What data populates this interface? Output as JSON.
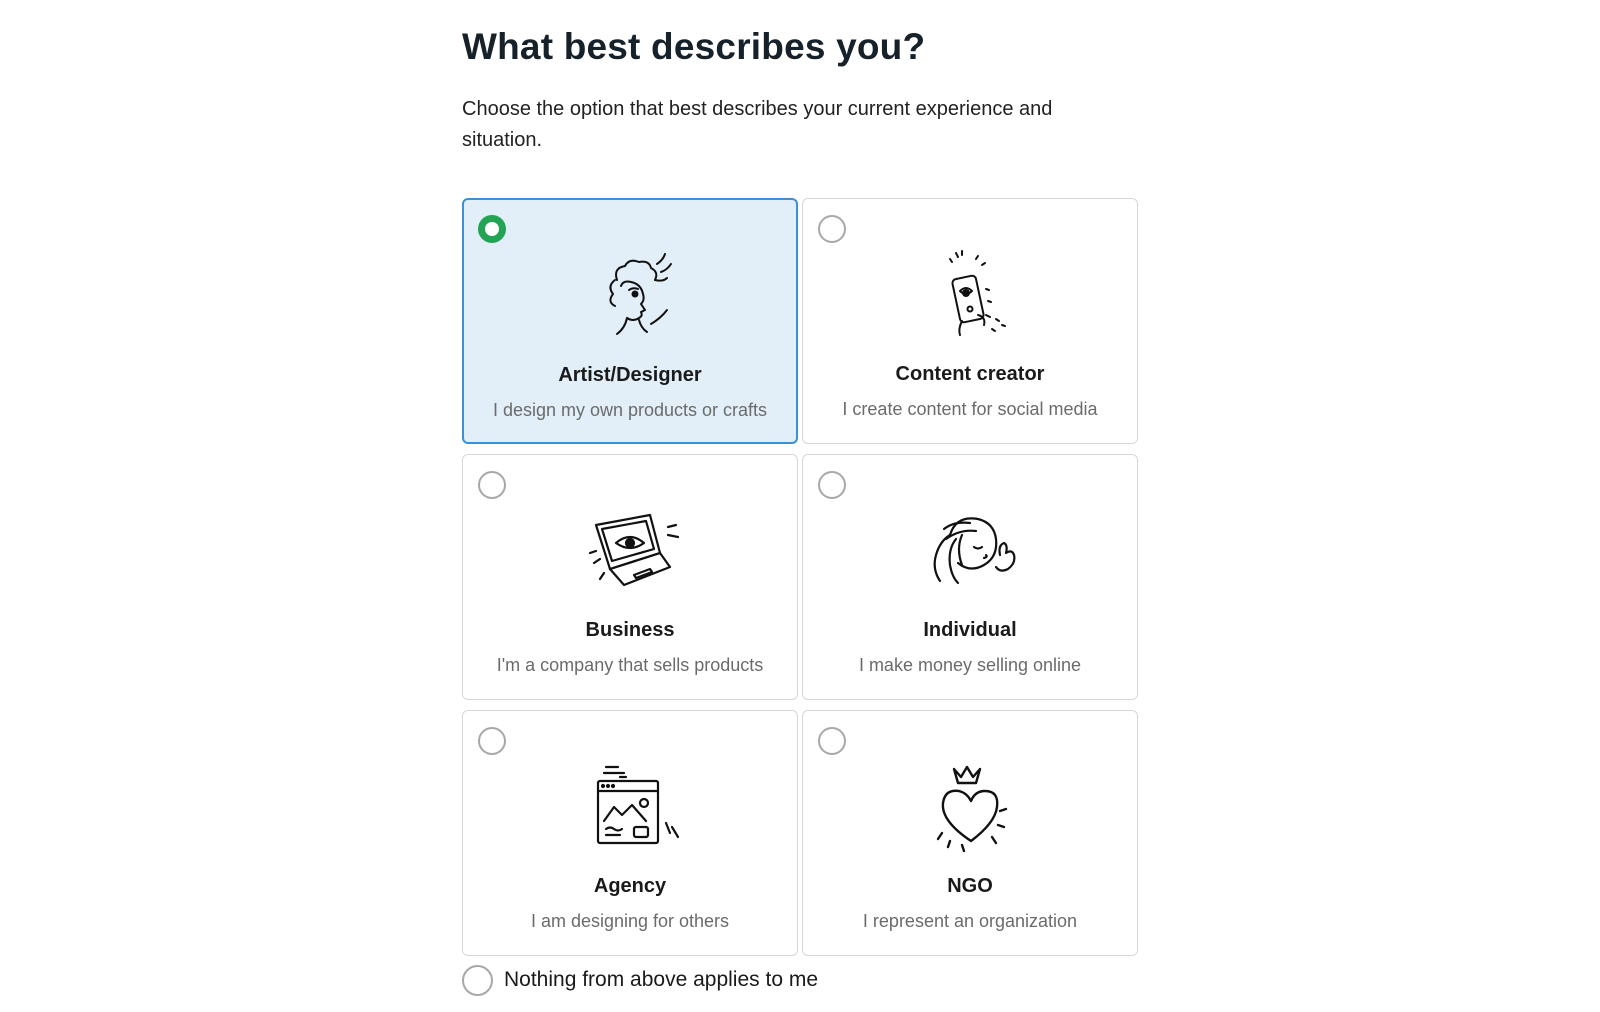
{
  "heading": "What best describes you?",
  "subtitle": "Choose the option that best describes your current experience and situation.",
  "accent_color": "#3d8fd6",
  "check_color": "#23a455",
  "options": [
    {
      "title": "Artist/Designer",
      "description": "I design my own products or crafts",
      "icon": "artist-icon",
      "selected": true
    },
    {
      "title": "Content creator",
      "description": "I create content for social media",
      "icon": "phone-creator-icon",
      "selected": false
    },
    {
      "title": "Business",
      "description": "I'm a company that sells products",
      "icon": "laptop-icon",
      "selected": false
    },
    {
      "title": "Individual",
      "description": "I make money selling online",
      "icon": "waving-person-icon",
      "selected": false
    },
    {
      "title": "Agency",
      "description": "I am designing for others",
      "icon": "browser-window-icon",
      "selected": false
    },
    {
      "title": "NGO",
      "description": "I represent an organization",
      "icon": "crowned-heart-icon",
      "selected": false
    }
  ],
  "none_option": {
    "label": "Nothing from above applies to me",
    "selected": false
  }
}
